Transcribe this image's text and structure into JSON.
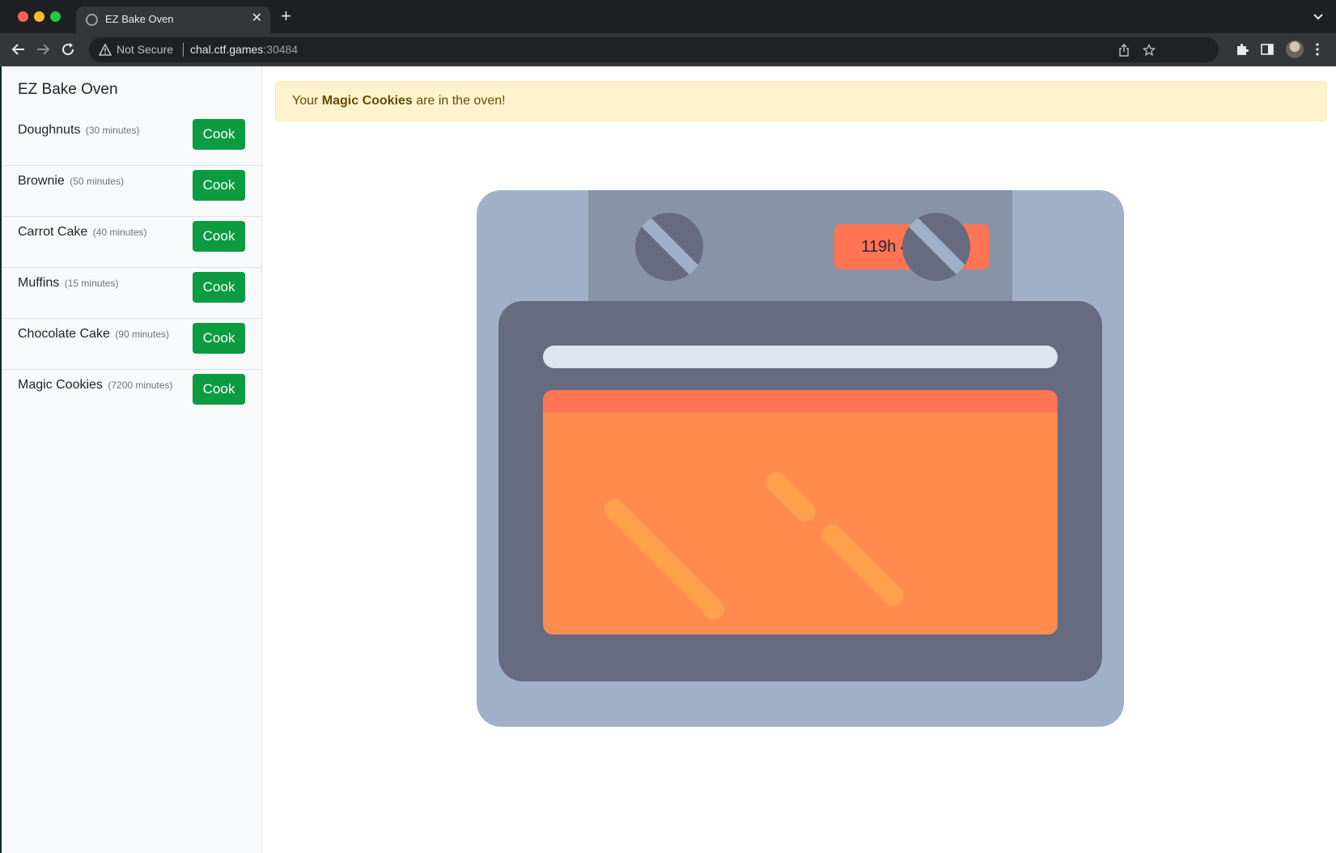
{
  "browser": {
    "tab_title": "EZ Bake Oven",
    "tab_close": "✕",
    "new_tab": "+",
    "security_label": "Not Secure",
    "url_host": "chal.ctf.games",
    "url_port": ":30484"
  },
  "sidebar": {
    "title": "EZ Bake Oven",
    "items": [
      {
        "name": "Doughnuts",
        "time": "(30 minutes)",
        "button": "Cook"
      },
      {
        "name": "Brownie",
        "time": "(50 minutes)",
        "button": "Cook"
      },
      {
        "name": "Carrot Cake",
        "time": "(40 minutes)",
        "button": "Cook"
      },
      {
        "name": "Muffins",
        "time": "(15 minutes)",
        "button": "Cook"
      },
      {
        "name": "Chocolate Cake",
        "time": "(90 minutes)",
        "button": "Cook"
      },
      {
        "name": "Magic Cookies",
        "time": "(7200 minutes)",
        "button": "Cook"
      }
    ]
  },
  "alert": {
    "prefix": "Your",
    "item": "Magic Cookies",
    "suffix": "are in the oven!"
  },
  "oven": {
    "timer": "119h 47m 33s"
  },
  "colors": {
    "cook_button": "#0d9b41",
    "alert_bg": "#fff3cd",
    "oven_body": "#a0b0c9",
    "oven_door": "#666b7f",
    "timer_bg": "#ff7452",
    "oven_window": "#ff8b4f"
  }
}
